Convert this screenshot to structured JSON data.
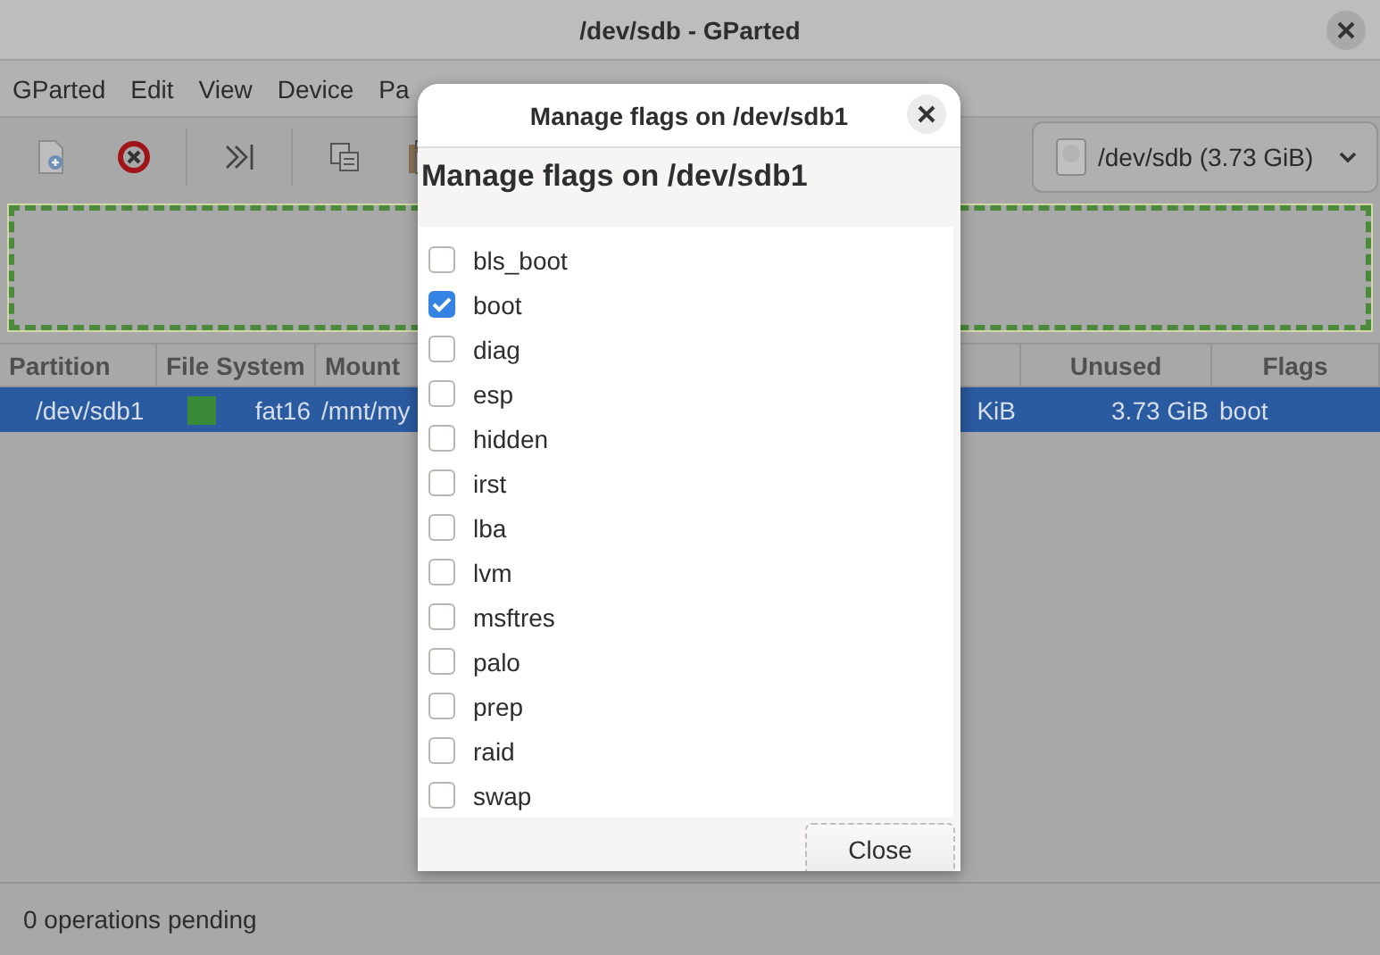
{
  "window": {
    "title": "/dev/sdb - GParted"
  },
  "menu": [
    "GParted",
    "Edit",
    "View",
    "Device",
    "Pa"
  ],
  "device_selector": {
    "value": "/dev/sdb (3.73 GiB)"
  },
  "table": {
    "columns": [
      "Partition",
      "File System",
      "Mount",
      "Unused",
      "Flags"
    ],
    "rows": [
      {
        "partition": "/dev/sdb1",
        "color": "#3a8a3a",
        "file_system": "fat16",
        "mount": "/mnt/my",
        "used": "KiB",
        "unused": "3.73 GiB",
        "flags": "boot",
        "selected": true
      }
    ]
  },
  "status_bar": "0 operations pending",
  "dialog": {
    "title": "Manage flags on /dev/sdb1",
    "heading": "Manage flags on /dev/sdb1",
    "flags": [
      {
        "label": "bls_boot",
        "checked": false
      },
      {
        "label": "boot",
        "checked": true
      },
      {
        "label": "diag",
        "checked": false
      },
      {
        "label": "esp",
        "checked": false
      },
      {
        "label": "hidden",
        "checked": false
      },
      {
        "label": "irst",
        "checked": false
      },
      {
        "label": "lba",
        "checked": false
      },
      {
        "label": "lvm",
        "checked": false
      },
      {
        "label": "msftres",
        "checked": false
      },
      {
        "label": "palo",
        "checked": false
      },
      {
        "label": "prep",
        "checked": false
      },
      {
        "label": "raid",
        "checked": false
      },
      {
        "label": "swap",
        "checked": false
      }
    ],
    "close_button": "Close"
  }
}
